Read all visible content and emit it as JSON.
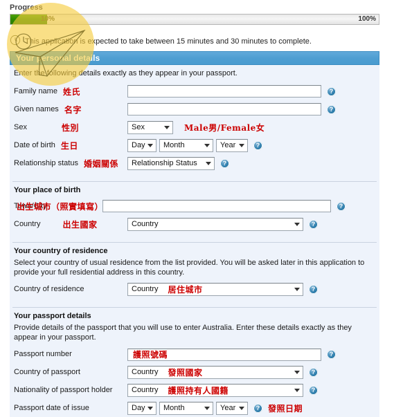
{
  "progress": {
    "label": "Progress",
    "percent_text": "10%",
    "max_text": "100%",
    "percent_value": 10,
    "fill_color": "#2f8a00"
  },
  "notice": {
    "icon": "clock-icon",
    "text": "This application is expected to take between 15 minutes and 30 minutes to complete."
  },
  "section": {
    "title": "Your personal details",
    "accent_color": "#4f9ed2",
    "intro": "Enter the following details exactly as they appear in your passport."
  },
  "help_icon_label": "?",
  "personal": {
    "family_name": {
      "label": "Family name",
      "annotation": "姓氏",
      "value": "",
      "help": "?"
    },
    "given_names": {
      "label": "Given names",
      "annotation": "名字",
      "value": "",
      "help": "?"
    },
    "sex": {
      "label": "Sex",
      "annotation": "性別",
      "selected": "Sex",
      "options": [
        "Sex",
        "Male",
        "Female"
      ],
      "note": "Male男/Female女"
    },
    "date_of_birth": {
      "label": "Date of birth",
      "annotation": "生日",
      "day": "Day",
      "month": "Month",
      "year": "Year",
      "help": "?"
    },
    "relationship_status": {
      "label": "Relationship status",
      "annotation": "婚姻關係",
      "selected": "Relationship Status",
      "help": "?"
    }
  },
  "place_of_birth": {
    "heading": "Your place of birth",
    "town_city": {
      "label": "Town/City",
      "annotation": "出生城市（照實填寫）",
      "value": "",
      "help": "?"
    },
    "country": {
      "label": "Country",
      "annotation": "出生國家",
      "selected": "Country",
      "help": "?"
    }
  },
  "country_of_residence": {
    "heading": "Your country of residence",
    "description": "Select your country of usual residence from the list provided. You will be asked later in this application to provide your full residential address in this country.",
    "field": {
      "label": "Country of residence",
      "selected": "Country",
      "annotation": "居住城市",
      "help": "?"
    }
  },
  "passport": {
    "heading": "Your passport details",
    "description": "Provide details of the passport that you will use to enter Australia. Enter these details exactly as they appear in your passport.",
    "number": {
      "label": "Passport number",
      "annotation": "護照號碼",
      "value": "",
      "help": "?"
    },
    "country": {
      "label": "Country of passport",
      "selected": "Country",
      "annotation": "發照國家",
      "help": "?"
    },
    "nationality": {
      "label": "Nationality of passport holder",
      "selected": "Country",
      "annotation": "護照持有人國籍",
      "help": "?"
    },
    "date_of_issue": {
      "label": "Passport date of issue",
      "day": "Day",
      "month": "Month",
      "year": "Year",
      "help": "?",
      "annotation": "發照日期"
    }
  },
  "watermark": {
    "name": "paper-plane-clock-watermark",
    "color": "#f5cc3b"
  }
}
